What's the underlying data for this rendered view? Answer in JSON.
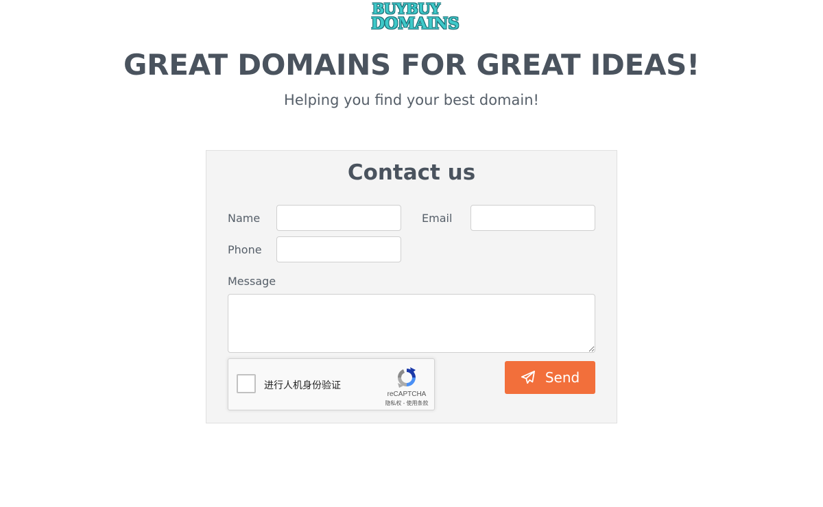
{
  "logo": {
    "line1": "BUYBUY",
    "line2": "DOMAINS"
  },
  "hero": {
    "title": "GREAT DOMAINS FOR GREAT IDEAS!",
    "subtitle": "Helping you find your best domain!"
  },
  "contact_form": {
    "title": "Contact us",
    "name_label": "Name",
    "name_value": "",
    "email_label": "Email",
    "email_value": "",
    "phone_label": "Phone",
    "phone_value": "",
    "message_label": "Message",
    "message_value": "",
    "send_label": "Send",
    "send_icon": "paper-plane-icon"
  },
  "recaptcha": {
    "checkbox_label": "进行人机身份验证",
    "brand": "reCAPTCHA",
    "links": "隐私权 - 使用条款",
    "checked": false
  },
  "colors": {
    "accent": "#f26f3b",
    "text": "#4a535e",
    "panel_bg": "#f4f4f4",
    "logo": "#3ec9c9"
  }
}
